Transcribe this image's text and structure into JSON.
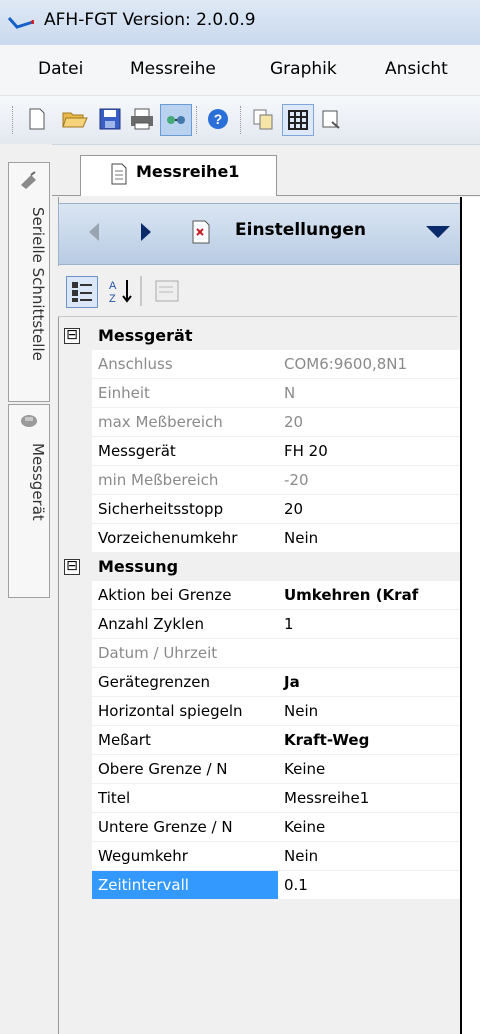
{
  "window": {
    "title": "AFH-FGT  Version: 2.0.0.9"
  },
  "menu": [
    "Datei",
    "Messreihe",
    "Graphik",
    "Ansicht"
  ],
  "toolbar": {
    "icons": [
      "new-doc-icon",
      "open-folder-icon",
      "save-icon",
      "print-icon",
      "connect-icon",
      "help-icon",
      "copy-icon",
      "grid-icon",
      "zoom-window-icon"
    ]
  },
  "left_tabs": [
    "Serielle Schnittstelle",
    "Messgerät"
  ],
  "doc_tab": {
    "label": "Messreihe1"
  },
  "panel": {
    "header_title": "Einstellungen"
  },
  "categories": [
    {
      "title": "Messgerät",
      "toggle": "⊟",
      "rows": [
        {
          "name": "Anschluss",
          "value": "COM6:9600,8N1",
          "readonly": true
        },
        {
          "name": "Einheit",
          "value": "N",
          "readonly": true
        },
        {
          "name": "max Meßbereich",
          "value": "20",
          "readonly": true
        },
        {
          "name": "Messgerät",
          "value": "FH 20"
        },
        {
          "name": "min Meßbereich",
          "value": "-20",
          "readonly": true
        },
        {
          "name": "Sicherheitsstopp",
          "value": "20"
        },
        {
          "name": "Vorzeichenumkehr",
          "value": "Nein"
        }
      ]
    },
    {
      "title": "Messung",
      "toggle": "⊟",
      "rows": [
        {
          "name": "Aktion bei Grenze",
          "value": "Umkehren (Kraf",
          "bold": true
        },
        {
          "name": "Anzahl Zyklen",
          "value": "1"
        },
        {
          "name": "Datum / Uhrzeit",
          "value": "",
          "readonly": true
        },
        {
          "name": "Gerätegrenzen",
          "value": "Ja",
          "bold": true
        },
        {
          "name": "Horizontal spiegeln",
          "value": "Nein"
        },
        {
          "name": "Meßart",
          "value": "Kraft-Weg",
          "bold": true
        },
        {
          "name": "Obere Grenze / N",
          "value": "Keine"
        },
        {
          "name": "Titel",
          "value": "Messreihe1"
        },
        {
          "name": "Untere Grenze / N",
          "value": "Keine"
        },
        {
          "name": "Wegumkehr",
          "value": "Nein"
        },
        {
          "name": "Zeitintervall",
          "value": "0.1",
          "selected": true
        }
      ]
    }
  ]
}
